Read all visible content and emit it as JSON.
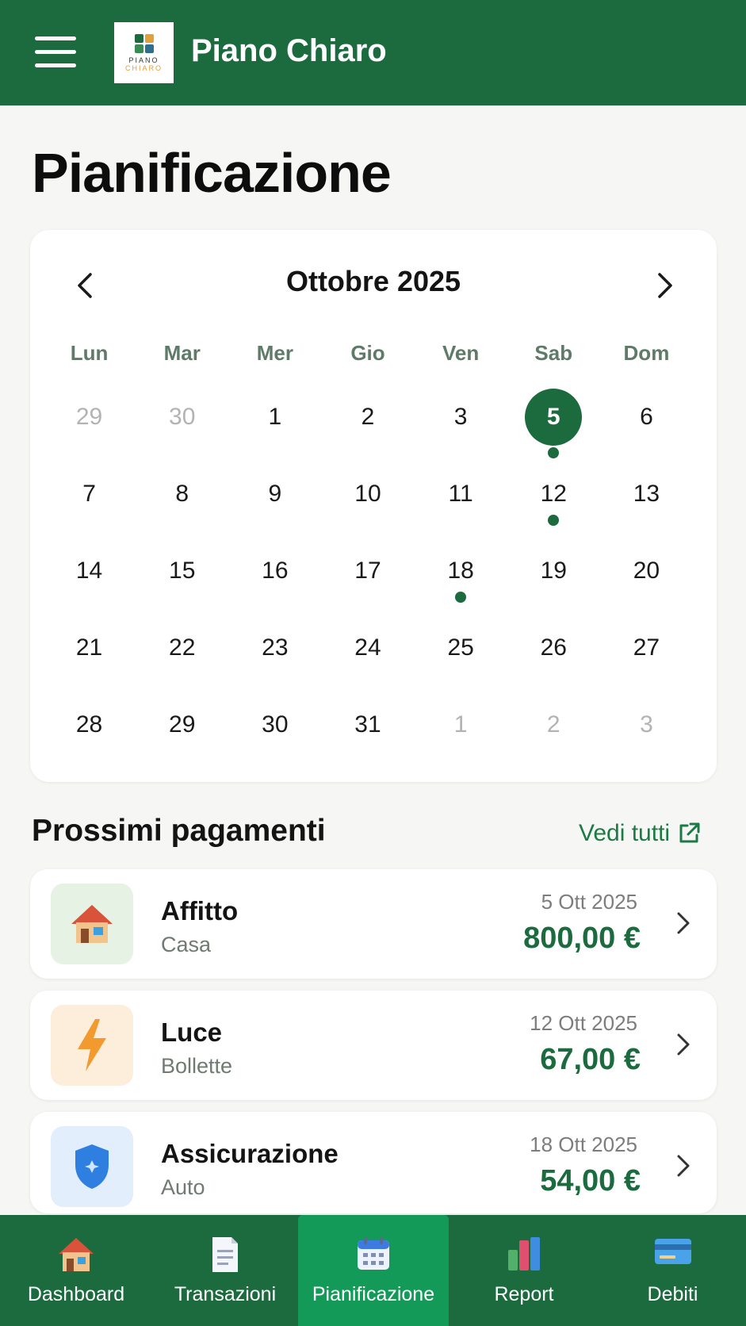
{
  "header": {
    "title": "Piano Chiaro",
    "logo_line1": "PIANO",
    "logo_line2": "CHIARO",
    "logo_colors": [
      "#1c6b3f",
      "#e0a03a",
      "#3a8a55",
      "#2f6e8c"
    ]
  },
  "page_title": "Pianificazione",
  "calendar": {
    "month_label": "Ottobre 2025",
    "weekdays": [
      "Lun",
      "Mar",
      "Mer",
      "Gio",
      "Ven",
      "Sab",
      "Dom"
    ],
    "days": [
      {
        "label": "29",
        "muted": true
      },
      {
        "label": "30",
        "muted": true
      },
      {
        "label": "1"
      },
      {
        "label": "2"
      },
      {
        "label": "3"
      },
      {
        "label": "5",
        "selected": true,
        "event": true
      },
      {
        "label": "6"
      },
      {
        "label": "7"
      },
      {
        "label": "8"
      },
      {
        "label": "9"
      },
      {
        "label": "10"
      },
      {
        "label": "11"
      },
      {
        "label": "12",
        "event": true
      },
      {
        "label": "13"
      },
      {
        "label": "14"
      },
      {
        "label": "15"
      },
      {
        "label": "16"
      },
      {
        "label": "17"
      },
      {
        "label": "18",
        "event": true
      },
      {
        "label": "19"
      },
      {
        "label": "20"
      },
      {
        "label": "21"
      },
      {
        "label": "22"
      },
      {
        "label": "23"
      },
      {
        "label": "24"
      },
      {
        "label": "25"
      },
      {
        "label": "26"
      },
      {
        "label": "27"
      },
      {
        "label": "28"
      },
      {
        "label": "29"
      },
      {
        "label": "30"
      },
      {
        "label": "31"
      },
      {
        "label": "1",
        "muted": true
      },
      {
        "label": "2",
        "muted": true
      },
      {
        "label": "3",
        "muted": true
      }
    ],
    "accent_color": "#1c6b3f"
  },
  "payments_section": {
    "title": "Prossimi pagamenti",
    "see_all_label": "Vedi tutti"
  },
  "payments": [
    {
      "name": "Affitto",
      "category": "Casa",
      "date": "5 Ott 2025",
      "amount": "800,00 €",
      "icon": "house-icon",
      "icon_bg": "#e6f3e4"
    },
    {
      "name": "Luce",
      "category": "Bollette",
      "date": "12 Ott 2025",
      "amount": "67,00 €",
      "icon": "lightning-icon",
      "icon_bg": "#fdeedb"
    },
    {
      "name": "Assicurazione",
      "category": "Auto",
      "date": "18 Ott 2025",
      "amount": "54,00 €",
      "icon": "shield-icon",
      "icon_bg": "#e2eefb"
    }
  ],
  "nav": [
    {
      "label": "Dashboard",
      "icon": "house-icon"
    },
    {
      "label": "Transazioni",
      "icon": "document-icon"
    },
    {
      "label": "Pianificazione",
      "icon": "calendar-icon",
      "active": true
    },
    {
      "label": "Report",
      "icon": "bar-chart-icon"
    },
    {
      "label": "Debiti",
      "icon": "credit-card-icon"
    }
  ]
}
